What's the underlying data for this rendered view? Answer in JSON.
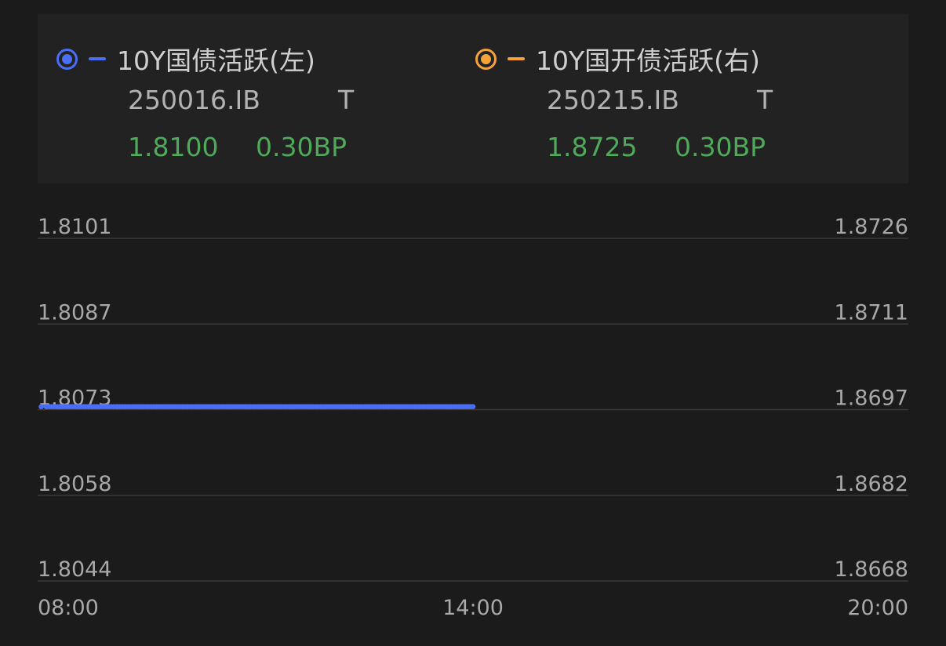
{
  "legend": [
    {
      "name": "10Y国债活跃(左)",
      "code": "250016.IB",
      "flag": "T",
      "value": "1.8100",
      "change": "0.30BP",
      "color": "#4a6ef5"
    },
    {
      "name": "10Y国开债活跃(右)",
      "code": "250215.IB",
      "flag": "T",
      "value": "1.8725",
      "change": "0.30BP",
      "color": "#f5a23a"
    }
  ],
  "chart_data": {
    "type": "line",
    "x_ticks": [
      "08:00",
      "14:00",
      "20:00"
    ],
    "y_left_ticks": [
      "1.8101",
      "1.8087",
      "1.8073",
      "1.8058",
      "1.8044"
    ],
    "y_right_ticks": [
      "1.8726",
      "1.8711",
      "1.8697",
      "1.8682",
      "1.8668"
    ],
    "y_left_range": [
      1.8044,
      1.8101
    ],
    "y_right_range": [
      1.8668,
      1.8726
    ],
    "x_range_minutes": [
      0,
      720
    ],
    "grid": "horizontal",
    "series": [
      {
        "name": "10Y国债活跃(左)",
        "axis": "left",
        "color": "#4a6ef5",
        "points": [
          [
            3,
            1.8073
          ],
          [
            7,
            1.8073
          ],
          [
            8,
            1.8073
          ],
          [
            10,
            1.8073
          ],
          [
            12,
            1.8073
          ],
          [
            14,
            1.8073
          ],
          [
            16,
            1.8073
          ],
          [
            18,
            1.8073
          ],
          [
            20,
            1.8073
          ],
          [
            22,
            1.8073
          ],
          [
            24,
            1.8073
          ],
          [
            26,
            1.8073
          ],
          [
            28,
            1.8073
          ],
          [
            30,
            1.8073
          ],
          [
            32,
            1.8073
          ],
          [
            34,
            1.8073
          ],
          [
            36,
            1.8073
          ],
          [
            38,
            1.8073
          ],
          [
            40,
            1.8073
          ],
          [
            42,
            1.8073
          ],
          [
            44,
            1.8073
          ],
          [
            45,
            1.8073
          ],
          [
            47,
            1.8073
          ],
          [
            49,
            1.8073
          ],
          [
            51,
            1.8073
          ],
          [
            53,
            1.8073
          ],
          [
            55,
            1.8073
          ],
          [
            57,
            1.8073
          ],
          [
            59,
            1.8073
          ],
          [
            61,
            1.8073
          ],
          [
            63,
            1.8073
          ],
          [
            65,
            1.8073
          ],
          [
            66,
            1.8073
          ],
          [
            68,
            1.8073
          ],
          [
            70,
            1.8073
          ],
          [
            72,
            1.8073
          ],
          [
            74,
            1.8073
          ],
          [
            76,
            1.8073
          ],
          [
            78,
            1.8073
          ],
          [
            80,
            1.8073
          ],
          [
            82,
            1.8073
          ],
          [
            84,
            1.8073
          ],
          [
            86,
            1.8073
          ],
          [
            88,
            1.8073
          ],
          [
            90,
            1.8073
          ],
          [
            92,
            1.8073
          ],
          [
            94,
            1.8073
          ],
          [
            96,
            1.8073
          ],
          [
            98,
            1.8073
          ],
          [
            100,
            1.8073
          ],
          [
            102,
            1.8073
          ],
          [
            104,
            1.8073
          ],
          [
            106,
            1.8073
          ],
          [
            108,
            1.8073
          ],
          [
            110,
            1.8073
          ],
          [
            112,
            1.8073
          ],
          [
            114,
            1.8073
          ],
          [
            116,
            1.8073
          ],
          [
            118,
            1.8073
          ],
          [
            120,
            1.8073
          ],
          [
            122,
            1.8073
          ],
          [
            124,
            1.8073
          ],
          [
            126,
            1.8073
          ],
          [
            128,
            1.8073
          ],
          [
            130,
            1.8073
          ],
          [
            132,
            1.8073
          ],
          [
            134,
            1.8073
          ],
          [
            136,
            1.8073
          ],
          [
            138,
            1.8073
          ],
          [
            140,
            1.8073
          ],
          [
            142,
            1.8073
          ],
          [
            144,
            1.8073
          ],
          [
            146,
            1.8073
          ],
          [
            148,
            1.8073
          ],
          [
            150,
            1.8073
          ],
          [
            152,
            1.8073
          ],
          [
            154,
            1.8073
          ],
          [
            156,
            1.8073
          ],
          [
            158,
            1.8073
          ],
          [
            160,
            1.8073
          ],
          [
            162,
            1.8073
          ],
          [
            164,
            1.8073
          ],
          [
            166,
            1.8073
          ],
          [
            168,
            1.8073
          ],
          [
            170,
            1.8073
          ],
          [
            172,
            1.8073
          ],
          [
            174,
            1.8073
          ],
          [
            176,
            1.8073
          ],
          [
            178,
            1.8073
          ],
          [
            180,
            1.8073
          ],
          [
            182,
            1.8073
          ],
          [
            184,
            1.8073
          ],
          [
            186,
            1.8073
          ],
          [
            188,
            1.8073
          ],
          [
            190,
            1.8073
          ],
          [
            192,
            1.8073
          ],
          [
            194,
            1.8073
          ],
          [
            196,
            1.8073
          ],
          [
            198,
            1.8073
          ],
          [
            200,
            1.8073
          ],
          [
            202,
            1.8073
          ],
          [
            204,
            1.8073
          ],
          [
            206,
            1.8073
          ],
          [
            208,
            1.8073
          ],
          [
            210,
            1.8073
          ],
          [
            212,
            1.8073
          ],
          [
            214,
            1.8073
          ],
          [
            216,
            1.8073
          ],
          [
            218,
            1.8073
          ],
          [
            220,
            1.8073
          ],
          [
            222,
            1.8073
          ],
          [
            224,
            1.8073
          ],
          [
            226,
            1.8073
          ],
          [
            228,
            1.8073
          ],
          [
            230,
            1.8073
          ],
          [
            232,
            1.8073
          ],
          [
            234,
            1.8073
          ],
          [
            236,
            1.8073
          ],
          [
            238,
            1.8073
          ],
          [
            240,
            1.8073
          ],
          [
            242,
            1.8073
          ],
          [
            244,
            1.8073
          ],
          [
            246,
            1.8073
          ],
          [
            248,
            1.8073
          ],
          [
            250,
            1.8073
          ],
          [
            252,
            1.8073
          ],
          [
            254,
            1.8073
          ],
          [
            256,
            1.8073
          ],
          [
            258,
            1.8073
          ],
          [
            260,
            1.8073
          ],
          [
            262,
            1.8073
          ],
          [
            264,
            1.8073
          ],
          [
            266,
            1.8073
          ],
          [
            268,
            1.8073
          ],
          [
            270,
            1.8073
          ],
          [
            272,
            1.8073
          ],
          [
            274,
            1.8073
          ],
          [
            276,
            1.8073
          ],
          [
            278,
            1.8073
          ],
          [
            280,
            1.8073
          ],
          [
            282,
            1.8073
          ],
          [
            284,
            1.8073
          ],
          [
            286,
            1.8073
          ],
          [
            288,
            1.8073
          ],
          [
            290,
            1.8073
          ],
          [
            292,
            1.8073
          ],
          [
            294,
            1.8073
          ],
          [
            296,
            1.8073
          ],
          [
            298,
            1.8073
          ],
          [
            300,
            1.8073
          ],
          [
            302,
            1.8073
          ],
          [
            304,
            1.8073
          ],
          [
            306,
            1.8073
          ],
          [
            308,
            1.8073
          ],
          [
            310,
            1.8073
          ],
          [
            312,
            1.8073
          ],
          [
            314,
            1.8073
          ],
          [
            316,
            1.8073
          ],
          [
            318,
            1.8073
          ],
          [
            320,
            1.8073
          ],
          [
            322,
            1.8073
          ],
          [
            324,
            1.8073
          ],
          [
            326,
            1.8073
          ],
          [
            328,
            1.8073
          ],
          [
            330,
            1.8073
          ],
          [
            332,
            1.8073
          ],
          [
            334,
            1.8073
          ],
          [
            336,
            1.8073
          ],
          [
            338,
            1.8073
          ],
          [
            340,
            1.8073
          ],
          [
            342,
            1.8073
          ],
          [
            344,
            1.8073
          ],
          [
            346,
            1.8073
          ],
          [
            348,
            1.8073
          ],
          [
            350,
            1.8073
          ],
          [
            352,
            1.8073
          ],
          [
            354,
            1.8073
          ],
          [
            356,
            1.8073
          ],
          [
            358,
            1.8073
          ],
          [
            360,
            1.8073
          ]
        ]
      }
    ]
  }
}
